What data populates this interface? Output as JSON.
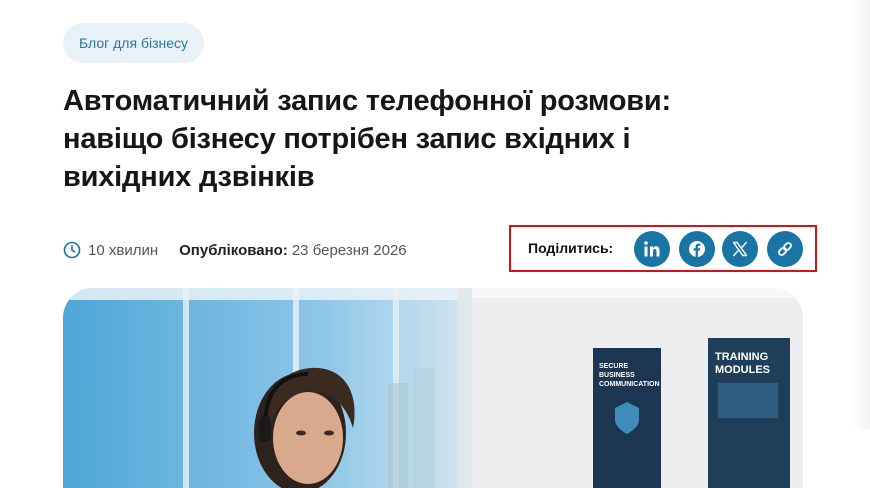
{
  "tag": {
    "label": "Блог для бізнесу"
  },
  "article": {
    "title": "Автоматичний запис телефонної розмови: навіщо бізнесу потрібен запис вхідних і вихідних дзвінків",
    "read_time": "10 хвилин",
    "published_label": "Опубліковано:",
    "published_date": "23 березня 2026"
  },
  "share": {
    "label": "Поділитись:",
    "buttons": [
      {
        "name": "linkedin",
        "icon": "linkedin-icon"
      },
      {
        "name": "facebook",
        "icon": "facebook-icon"
      },
      {
        "name": "x",
        "icon": "x-icon"
      },
      {
        "name": "copy-link",
        "icon": "link-icon"
      }
    ],
    "accent_color": "#1975a6",
    "highlight_color": "#d4121a"
  },
  "hero_image": {
    "posters": [
      {
        "lines": [
          "SECURE",
          "BUSINESS",
          "COMMUNICATION"
        ]
      },
      {
        "lines": [
          "TRAINING",
          "MODULES"
        ]
      }
    ]
  }
}
